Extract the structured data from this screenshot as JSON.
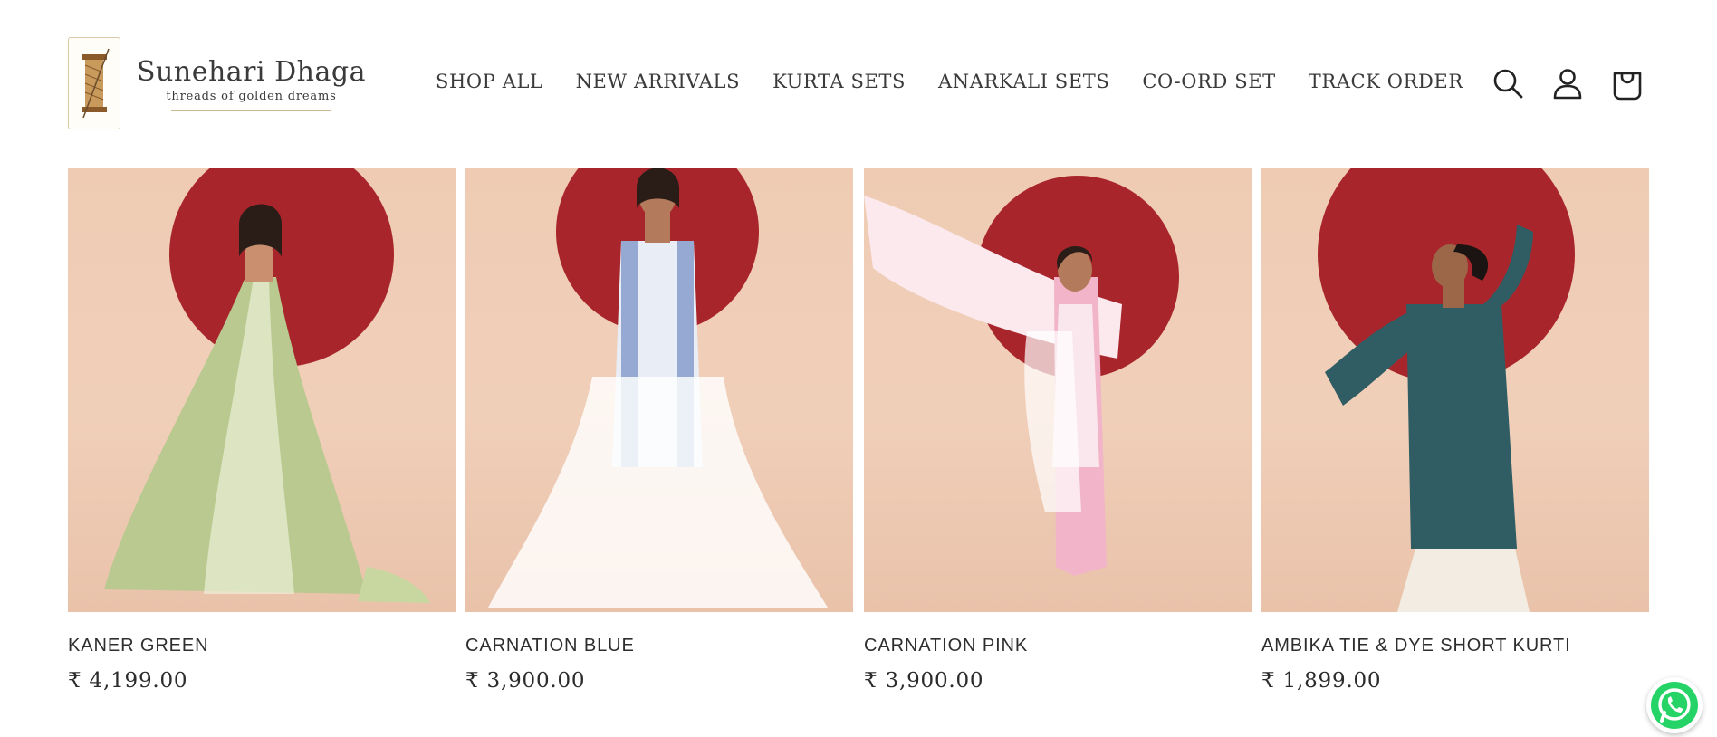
{
  "brand": {
    "name": "Sunehari Dhaga",
    "tagline": "threads of golden dreams"
  },
  "nav": {
    "items": [
      {
        "label": "SHOP ALL"
      },
      {
        "label": "NEW ARRIVALS"
      },
      {
        "label": "KURTA SETS"
      },
      {
        "label": "ANARKALI SETS"
      },
      {
        "label": "CO-ORD SET"
      },
      {
        "label": "TRACK ORDER"
      }
    ]
  },
  "header_icons": [
    "search-icon",
    "account-icon",
    "cart-icon"
  ],
  "products": [
    {
      "title": "KANER GREEN",
      "price": "₹ 4,199.00",
      "garment_color": "#b9c98f"
    },
    {
      "title": "CARNATION BLUE",
      "price": "₹ 3,900.00",
      "garment_color": "#e9eef6"
    },
    {
      "title": "CARNATION PINK",
      "price": "₹ 3,900.00",
      "garment_color": "#f1b4c8"
    },
    {
      "title": "AMBIKA TIE & DYE SHORT KURTI",
      "price": "₹ 1,899.00",
      "garment_color": "#2f5d63"
    }
  ],
  "colors": {
    "backdrop": "#efcbb3",
    "sun_disc": "#a8262b",
    "whatsapp": "#25d366"
  },
  "floating": {
    "icon": "whatsapp-icon"
  }
}
